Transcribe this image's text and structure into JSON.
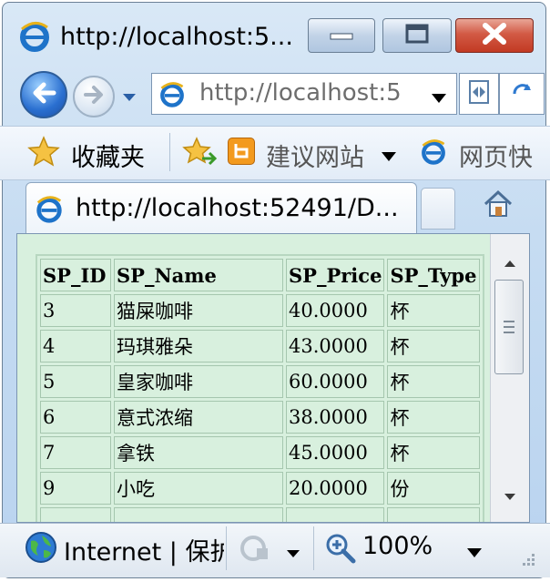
{
  "window": {
    "title": "http://localhost:5...",
    "minimize_icon": "minimize-icon",
    "maximize_icon": "maximize-icon",
    "close_icon": "close-icon"
  },
  "nav": {
    "address": "http://localhost:5",
    "back_icon": "back-arrow-icon",
    "forward_icon": "forward-arrow-icon"
  },
  "favorites": {
    "label": "收藏夹",
    "suggested_sites": "建议网站",
    "web_slice": "网页快"
  },
  "tab": {
    "title": "http://localhost:52491/D..."
  },
  "table": {
    "headers": [
      "SP_ID",
      "SP_Name",
      "SP_Price",
      "SP_Type"
    ],
    "rows": [
      [
        "3",
        "猫屎咖啡",
        "40.0000",
        "杯"
      ],
      [
        "4",
        "玛琪雅朵",
        "43.0000",
        "杯"
      ],
      [
        "5",
        "皇家咖啡",
        "60.0000",
        "杯"
      ],
      [
        "6",
        "意式浓缩",
        "38.0000",
        "杯"
      ],
      [
        "7",
        "拿铁",
        "45.0000",
        "杯"
      ],
      [
        "9",
        "小吃",
        "20.0000",
        "份"
      ]
    ]
  },
  "status": {
    "zone": "Internet | 保护",
    "zoom": "100%"
  },
  "colors": {
    "page_background": "#d8f0de",
    "close_button": "#c23a23",
    "window_frame": "#c6dcf2"
  }
}
